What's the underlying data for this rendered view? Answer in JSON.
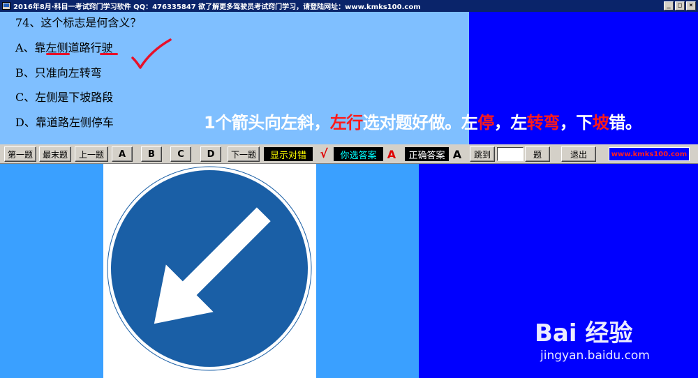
{
  "window": {
    "title": "2016年8月·科目一考试窍门学习软件  QQ：476335847 欲了解更多驾驶员考试窍门学习，请登陆网址：www.kmks100.com",
    "buttons": [
      "_",
      "□",
      "×"
    ]
  },
  "question": {
    "title": "74、这个标志是何含义？",
    "options": [
      {
        "label": "A、靠左侧道路行驶"
      },
      {
        "label": "B、只准向左转弯"
      },
      {
        "label": "C、左侧是下坡路段"
      },
      {
        "label": "D、靠道路左侧停车"
      }
    ]
  },
  "tip": {
    "parts": [
      {
        "text": "1个箭头向左斜，",
        "highlight": false
      },
      {
        "text": "左行",
        "highlight": true
      },
      {
        "text": "选对题好做。左",
        "highlight": false
      },
      {
        "text": "停",
        "highlight": true
      },
      {
        "text": "，左",
        "highlight": false
      },
      {
        "text": "转弯",
        "highlight": true
      },
      {
        "text": "，下",
        "highlight": false
      },
      {
        "text": "坡",
        "highlight": true
      },
      {
        "text": "错。",
        "highlight": false
      }
    ]
  },
  "toolbar": {
    "first": "第一题",
    "last": "最末题",
    "prev": "上一题",
    "opt_a": "A",
    "opt_b": "B",
    "opt_c": "C",
    "opt_d": "D",
    "next": "下一题",
    "show_label": "显示对错",
    "check_result": "√",
    "your_label": "你选答案",
    "your_answer": "A",
    "correct_label": "正确答案",
    "correct_answer": "A",
    "jump": "跳到",
    "question_unit": "题",
    "exit": "退出",
    "site": "www.kmks100.com"
  },
  "watermark": {
    "logo": "Bai 经验",
    "url": "jingyan.baidu.com"
  },
  "colors": {
    "question_bg": "#7fbfff",
    "panel_blue": "#0000ff",
    "sign_blue": "#1a5fa6",
    "accent_red": "#e8102a"
  }
}
